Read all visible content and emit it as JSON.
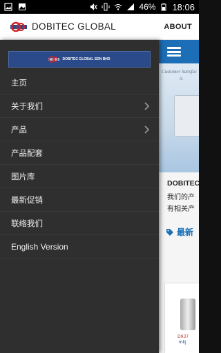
{
  "status_bar": {
    "battery": "46%",
    "time": "18:06"
  },
  "app_bar": {
    "title": "DOBITEC GLOBAL",
    "about_label": "ABOUT"
  },
  "drawer": {
    "logo_text": "DOBITEC GLOBAL SDN BHD",
    "items": [
      {
        "label": "主页",
        "has_chevron": false
      },
      {
        "label": "关于我们",
        "has_chevron": true
      },
      {
        "label": "产品",
        "has_chevron": true
      },
      {
        "label": "产品配套",
        "has_chevron": false
      },
      {
        "label": "图片库",
        "has_chevron": false
      },
      {
        "label": "最新促销",
        "has_chevron": false
      },
      {
        "label": "联络我们",
        "has_chevron": false
      },
      {
        "label": "English Version",
        "has_chevron": false
      }
    ]
  },
  "content": {
    "banner_text": "Customer Satisfac",
    "banner_text_2": "is",
    "title": "DOBITEC",
    "desc_line1": "我们的产",
    "desc_line2": "有相关产",
    "promo_label": "最新",
    "product_code": "D937",
    "product_name": "Inkj"
  },
  "colors": {
    "brand_blue": "#1c6fb6",
    "drawer_bg": "#2f2f2f",
    "logo_red": "#d2232a",
    "logo_blue": "#2b4a8a"
  }
}
